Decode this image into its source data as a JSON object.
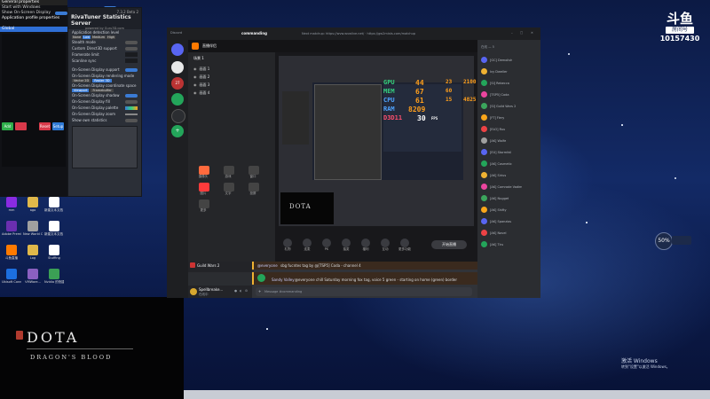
{
  "colors": {
    "discord_bg": "#313338",
    "discord_dark": "#1e1f22",
    "accent": "#5865f2",
    "osd_green": "#35d07f",
    "osd_orange": "#ff9f1c",
    "osd_blue": "#4fa3ff",
    "rtss_blue": "#3a7bd5"
  },
  "left_panel": {
    "title": "General properties",
    "items": [
      "Start with Windows",
      "Show On-Screen Display",
      "Application profile properties"
    ],
    "buttons": {
      "add": "Add",
      "setup": "Setup",
      "reset": "Reset",
      "save": "Setup"
    }
  },
  "rtss": {
    "title": "RivaTuner Statistics Server",
    "version": "7.3.2 Beta 2",
    "subtitle": "powered by Guru3D.com",
    "detect_label": "Application detection level",
    "detect_options": [
      "None",
      "Low",
      "Medium",
      "High"
    ],
    "rows": [
      "Stealth mode",
      "Custom Direct3D support",
      "Framerate limit",
      "Scanline sync",
      "On-Screen Display support",
      "On-Screen Display rendering mode",
      "On-Screen Display coordinate space",
      "On-Screen Display shadow",
      "On-Screen Display fill",
      "On-Screen Display palette",
      "On-Screen Display zoom",
      "Show own statistics"
    ],
    "render_modes": [
      "Vector 2D",
      "Raster 3D"
    ],
    "coord_modes": [
      "Viewport",
      "Framebuffer"
    ]
  },
  "desktop_icons": [
    {
      "label": "mm",
      "icon": "app-icon"
    },
    {
      "label": "ago",
      "icon": "folder-icon"
    },
    {
      "label": "新建文本文档 (3)",
      "icon": "text-file-icon"
    },
    {
      "label": "Adobe Premiere...",
      "icon": "premiere-icon"
    },
    {
      "label": "New World Closed Beta",
      "icon": "game-icon"
    },
    {
      "label": "新建文本文档 (2)",
      "icon": "text-file-icon"
    },
    {
      "label": "斗鱼直播",
      "icon": "douyu-icon"
    },
    {
      "label": "Log",
      "icon": "text-file-icon"
    },
    {
      "label": "Stuffing",
      "icon": "text-file-icon"
    },
    {
      "label": "Ubisoft Connect",
      "icon": "ubisoft-icon"
    },
    {
      "label": "VMWare...",
      "icon": "vm-icon"
    },
    {
      "label": "Nvidia 的快捷方式",
      "icon": "nvidia-icon"
    }
  ],
  "dota": {
    "title": "DOTA",
    "subtitle": "DRAGON'S BLOOD"
  },
  "douyu": {
    "logo": "斗鱼",
    "room_label": "房间号",
    "room_id": "10157430"
  },
  "discord": {
    "app_name": "Discord",
    "server_name": "For Shiverpeaks",
    "channel_name": "commanding",
    "topic": "Next matchup: https://wvw.wvwlive.net/ · https://gw2mists.com/matchup",
    "server_list_labels": [
      "27",
      "ATF"
    ],
    "sections": [
      "TEAM SPEAK",
      "语音频道"
    ],
    "user": {
      "name": "Spellbreake...",
      "status": "在线中"
    },
    "game_activity": "Guild Wars 2",
    "stream_title": "直播伴侣",
    "stream_scene_label": "场景 1",
    "stream_sources": [
      "画面 1",
      "画面 2",
      "画面 3",
      "画面 4"
    ],
    "stream_tools": [
      "摄像头",
      "游戏",
      "窗口",
      "图片",
      "文字",
      "投屏",
      "更多"
    ],
    "stream_bottom_tools": [
      "礼物",
      "连麦",
      "PK",
      "抽奖",
      "福利",
      "互动",
      "更多功能"
    ],
    "stream_live_button": "开始直播",
    "messages": [
      {
        "author": "@everyone",
        "text": "sbg fucntes tag by @[TSP5] Coda - channel 4"
      },
      {
        "author": "Sandy Valley",
        "text": "@everyone chill Saturday morning fox tag, voice 5 green - starting on home (green) border"
      }
    ],
    "input_placeholder": "Message #commanding",
    "members_heading": "在线 — 5",
    "members": [
      "[GC] Demolish",
      "Ivy Dweller",
      "[SI] Rebecca",
      "[TSP5] Coda",
      "[SI] Guild Wars 2",
      "[FT] Fiery",
      "[ELO] Ruu",
      "[AK] Wolfe",
      "[EU] Stormfall",
      "[AK] Cosmetic",
      "[AK] Sirius",
      "[AK] Comrade Vadim",
      "[AK] Nugget",
      "[AK] Shifty",
      "[AK] Spanzios",
      "[AK] Novel",
      "[AK] Tiru"
    ]
  },
  "osd": {
    "gpu_label": "GPU",
    "gpu_usage": "44",
    "gpu_temp": "23",
    "gpu_clock": "2100",
    "mem_label": "MEM",
    "mem_value": "67",
    "mem_temp": "60",
    "cpu_label": "CPU",
    "cpu_usage": "61",
    "cpu_temp": "15",
    "cpu_clock": "4825",
    "ram_label": "RAM",
    "ram_value": "8209",
    "d3d_label": "D3D11",
    "fps": "30",
    "fps_unit": "FPS"
  },
  "overlay_badge": {
    "value": "50%"
  },
  "windows_watermark": {
    "line1": "激活 Windows",
    "line2": "转到\"设置\"以激活 Windows。"
  }
}
